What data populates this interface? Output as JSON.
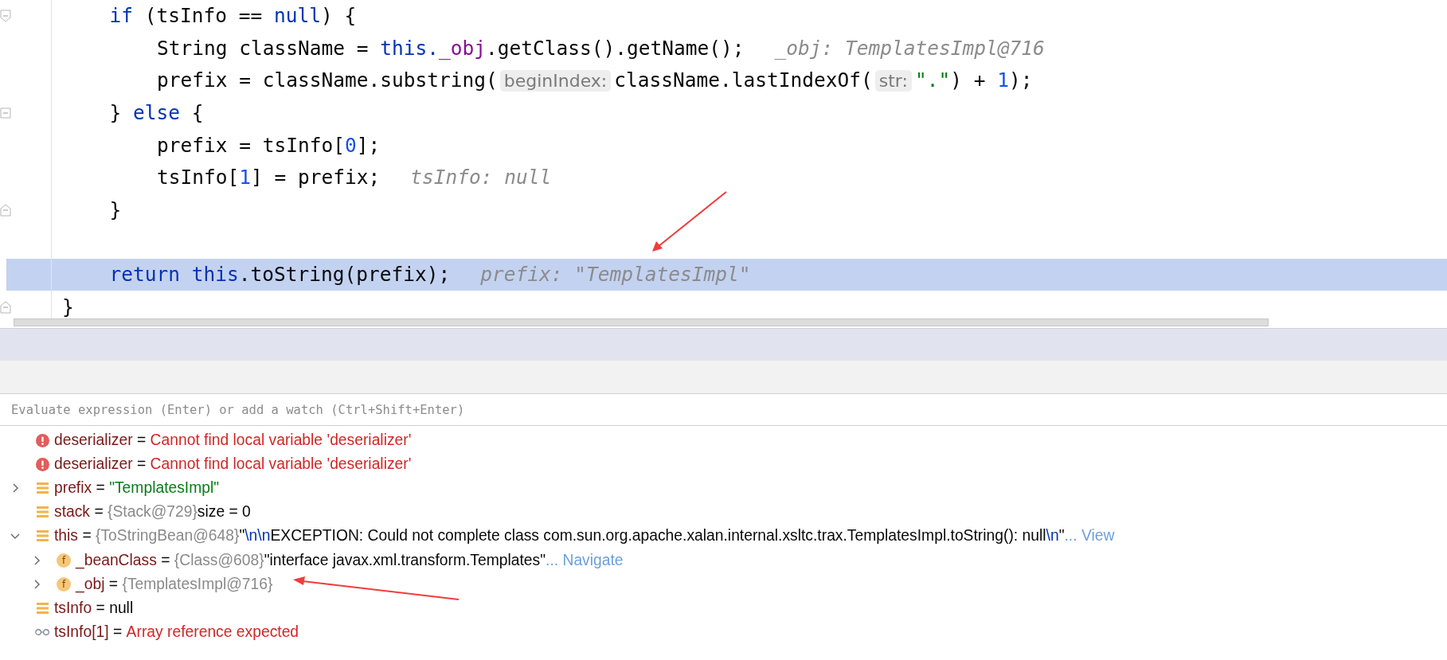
{
  "code_lines": [
    {
      "children": [
        {
          "kind": "block_start",
          "segments": [
            {
              "kind": "keyword",
              "text": "if"
            },
            {
              "kind": "plain",
              "text": " (tsInfo == "
            },
            {
              "kind": "keyword",
              "text": "null"
            },
            {
              "kind": "plain",
              "text": ") {"
            }
          ],
          "children": [
            {
              "kind": "line",
              "segments": [
                {
                  "kind": "plain",
                  "text": "String className = "
                },
                {
                  "kind": "keyword",
                  "text": "this."
                },
                {
                  "kind": "field",
                  "text": "_obj"
                },
                {
                  "kind": "plain",
                  "text": ".getClass().getName();"
                },
                {
                  "kind": "hint",
                  "text": "_obj: TemplatesImpl@716"
                }
              ]
            },
            {
              "kind": "line",
              "segments": [
                {
                  "kind": "plain",
                  "text": "prefix = className.substring("
                },
                {
                  "kind": "param",
                  "text": "beginIndex:"
                },
                {
                  "kind": "plain",
                  "text": "className.lastIndexOf("
                },
                {
                  "kind": "param",
                  "text": "str:"
                },
                {
                  "kind": "string",
                  "text": "\".\""
                },
                {
                  "kind": "plain",
                  "text": ") + "
                },
                {
                  "kind": "number",
                  "text": "1"
                },
                {
                  "kind": "plain",
                  "text": ");"
                }
              ]
            }
          ]
        },
        {
          "kind": "block_middle",
          "segments": [
            {
              "kind": "plain",
              "text": "} "
            },
            {
              "kind": "keyword",
              "text": "else"
            },
            {
              "kind": "plain",
              "text": " {"
            }
          ],
          "children": [
            {
              "kind": "line",
              "segments": [
                {
                  "kind": "plain",
                  "text": "prefix = tsInfo["
                },
                {
                  "kind": "number",
                  "text": "0"
                },
                {
                  "kind": "plain",
                  "text": "];"
                }
              ]
            },
            {
              "kind": "line",
              "segments": [
                {
                  "kind": "plain",
                  "text": "tsInfo["
                },
                {
                  "kind": "number",
                  "text": "1"
                },
                {
                  "kind": "plain",
                  "text": "] = prefix;"
                },
                {
                  "kind": "hint",
                  "text": "tsInfo: null"
                }
              ]
            }
          ]
        },
        {
          "kind": "block_end",
          "segments": [
            {
              "kind": "plain",
              "text": "}"
            }
          ]
        },
        {
          "kind": "line"
        },
        {
          "kind": "current_line",
          "segments": [
            {
              "kind": "keyword",
              "text": "return this"
            },
            {
              "kind": "plain",
              "text": ".toString(prefix);"
            },
            {
              "kind": "hint",
              "text": "prefix: \"TemplatesImpl\""
            }
          ]
        }
      ]
    },
    {
      "kind": "block_end",
      "segments": [
        {
          "kind": "plain",
          "text": "}"
        }
      ]
    }
  ],
  "watch_input": {
    "placeholder": "Evaluate expression (Enter) or add a watch (Ctrl+Shift+Enter)"
  },
  "variables": [
    {
      "kind": "error",
      "name": "deserializer",
      "separator": "=",
      "value": [
        {
          "kind": "error",
          "text": "Cannot find local variable 'deserializer'"
        }
      ]
    },
    {
      "kind": "error",
      "name": "deserializer",
      "separator": "=",
      "value": [
        {
          "kind": "error",
          "text": "Cannot find local variable 'deserializer'"
        }
      ]
    },
    {
      "kind": "variable",
      "name": "prefix",
      "separator": "=",
      "expanded": false,
      "value": [
        {
          "kind": "string",
          "text": "\"TemplatesImpl\""
        }
      ]
    },
    {
      "kind": "variable",
      "name": "stack",
      "separator": "=",
      "value": [
        {
          "kind": "ref",
          "text": "{Stack@729}"
        },
        {
          "kind": "plain",
          "text": "size = 0"
        }
      ]
    },
    {
      "kind": "variable",
      "name": "this",
      "separator": "=",
      "expanded": true,
      "value": [
        {
          "kind": "ref",
          "text": "{ToStringBean@648}"
        },
        {
          "kind": "plain",
          "text": "\""
        },
        {
          "kind": "escape",
          "text": "\\n\\n"
        },
        {
          "kind": "plain",
          "text": "EXCEPTION: Could not complete class com.sun.org.apache.xalan.internal.xsltc.trax.TemplatesImpl.toString(): null"
        },
        {
          "kind": "escape",
          "text": "\\n"
        },
        {
          "kind": "plain",
          "text": "\""
        },
        {
          "kind": "link",
          "text": "... View"
        }
      ],
      "children": [
        {
          "kind": "field",
          "badge": "f",
          "name": "_beanClass",
          "separator": "=",
          "expanded": false,
          "value": [
            {
              "kind": "ref",
              "text": "{Class@608}"
            },
            {
              "kind": "plain",
              "text": "\"interface javax.xml.transform.Templates\""
            },
            {
              "kind": "link",
              "text": "... Navigate"
            }
          ]
        },
        {
          "kind": "field",
          "badge": "f",
          "name": "_obj",
          "separator": "=",
          "expanded": false,
          "value": [
            {
              "kind": "ref",
              "text": "{TemplatesImpl@716}"
            }
          ]
        }
      ]
    },
    {
      "kind": "variable",
      "name": "tsInfo",
      "separator": "=",
      "value": [
        {
          "kind": "plain",
          "text": "null"
        }
      ]
    },
    {
      "kind": "watch",
      "name": "tsInfo[1]",
      "separator": "=",
      "value": [
        {
          "kind": "error",
          "text": "Array reference expected"
        }
      ]
    }
  ]
}
